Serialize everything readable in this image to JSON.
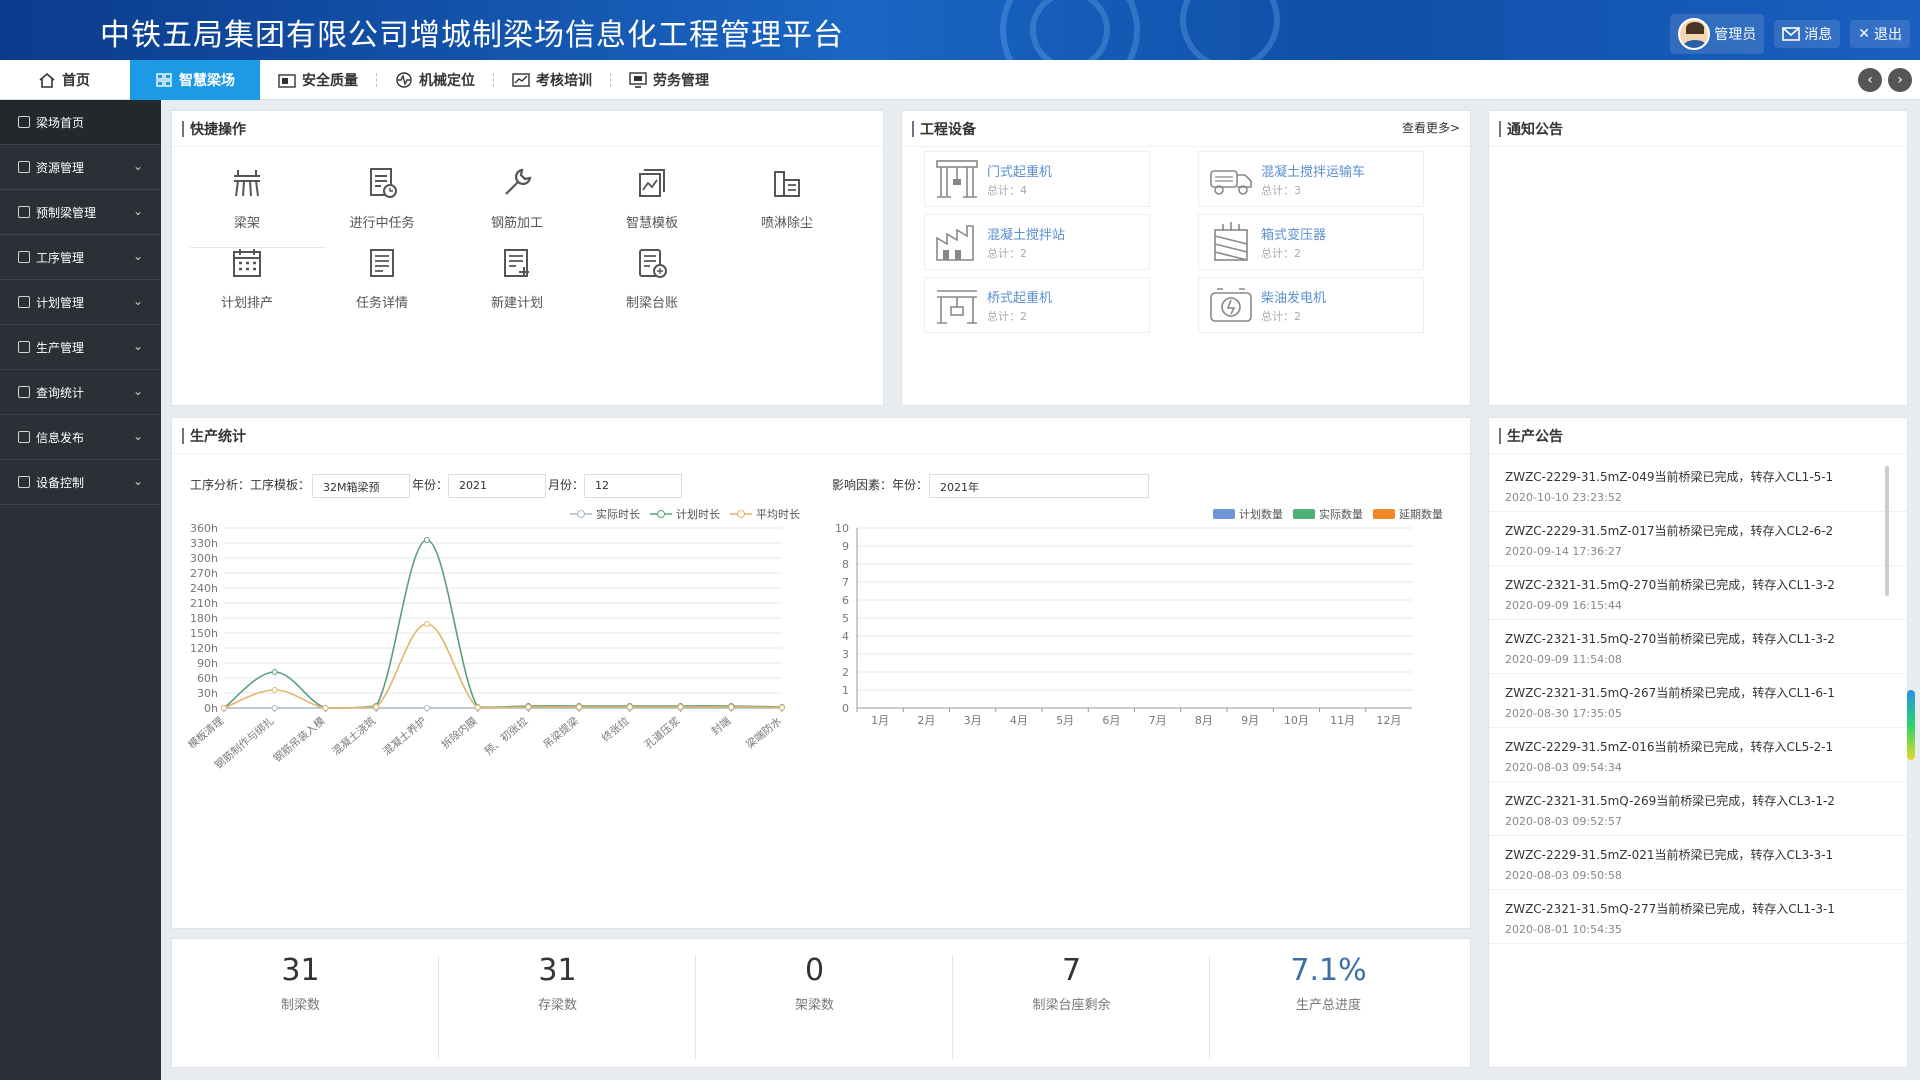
{
  "header": {
    "title": "中铁五局集团有限公司增城制梁场信息化工程管理平台",
    "user_label": "管理员",
    "message_label": "消息",
    "logout_label": "退出"
  },
  "nav": {
    "items": [
      {
        "label": "首页",
        "icon": "home-icon"
      },
      {
        "label": "智慧梁场",
        "icon": "grid-icon",
        "active": true
      },
      {
        "label": "安全质量",
        "icon": "camera-icon"
      },
      {
        "label": "机械定位",
        "icon": "pulse-icon"
      },
      {
        "label": "考核培训",
        "icon": "chart-icon"
      },
      {
        "label": "劳务管理",
        "icon": "monitor-icon"
      }
    ]
  },
  "sidebar": {
    "items": [
      {
        "label": "梁场首页",
        "icon": "home-icon"
      },
      {
        "label": "资源管理",
        "icon": "box-icon"
      },
      {
        "label": "预制梁管理",
        "icon": "beam-icon"
      },
      {
        "label": "工序管理",
        "icon": "layers-icon"
      },
      {
        "label": "计划管理",
        "icon": "doc-icon"
      },
      {
        "label": "生产管理",
        "icon": "factory-icon"
      },
      {
        "label": "查询统计",
        "icon": "scale-icon"
      },
      {
        "label": "信息发布",
        "icon": "file-icon"
      },
      {
        "label": "设备控制",
        "icon": "list-icon"
      }
    ]
  },
  "quick_ops": {
    "title": "快捷操作",
    "items": [
      {
        "label": "梁架",
        "icon": "bridge-icon"
      },
      {
        "label": "进行中任务",
        "icon": "task-icon"
      },
      {
        "label": "钢筋加工",
        "icon": "wrench-icon"
      },
      {
        "label": "智慧模板",
        "icon": "template-icon"
      },
      {
        "label": "喷淋除尘",
        "icon": "spray-icon"
      },
      {
        "label": "计划排产",
        "icon": "calendar-icon"
      },
      {
        "label": "任务详情",
        "icon": "detail-icon"
      },
      {
        "label": "新建计划",
        "icon": "new-plan-icon"
      },
      {
        "label": "制梁台账",
        "icon": "ledger-icon"
      }
    ]
  },
  "equipment": {
    "title": "工程设备",
    "more": "查看更多>",
    "items": [
      {
        "name": "门式起重机",
        "count": "总计：4",
        "icon": "gantry-crane-icon"
      },
      {
        "name": "混凝土搅拌运输车",
        "count": "总计：3",
        "icon": "mixer-truck-icon"
      },
      {
        "name": "混凝土搅拌站",
        "count": "总计：2",
        "icon": "mixing-plant-icon"
      },
      {
        "name": "箱式变压器",
        "count": "总计：2",
        "icon": "transformer-icon"
      },
      {
        "name": "桥式起重机",
        "count": "总计：2",
        "icon": "bridge-crane-icon"
      },
      {
        "name": "柴油发电机",
        "count": "总计：2",
        "icon": "generator-icon"
      }
    ]
  },
  "notice": {
    "title": "通知公告"
  },
  "production": {
    "title": "生产统计",
    "left_form": {
      "label1": "工序分析：工序模板：",
      "template": "32M箱梁预",
      "label2": "年份：",
      "year": "2021",
      "label3": "月份：",
      "month": "12"
    },
    "right_form": {
      "label1": "影响因素：年份：",
      "year": "2021年"
    }
  },
  "chart_data": [
    {
      "type": "line",
      "categories": [
        "模板清理",
        "钢筋制作与绑扎",
        "钢筋吊装入模",
        "混凝土浇筑",
        "混凝土养护",
        "拆除内膜",
        "预、初张拉",
        "吊梁提梁",
        "终张拉",
        "孔道压浆",
        "封端",
        "梁端防水"
      ],
      "series": [
        {
          "name": "实际时长",
          "color": "#a9b7c6",
          "values": [
            0,
            0,
            0,
            0,
            0,
            0,
            0,
            0,
            0,
            0,
            0,
            0
          ]
        },
        {
          "name": "计划时长",
          "color": "#5b9f7a",
          "values": [
            0,
            72,
            0,
            4,
            336,
            2,
            4,
            4,
            4,
            4,
            4,
            2
          ]
        },
        {
          "name": "平均时长",
          "color": "#e6b36b",
          "values": [
            0,
            36,
            0,
            2,
            168,
            1,
            2,
            2,
            2,
            2,
            2,
            1
          ]
        }
      ],
      "yticks": [
        "0h",
        "30h",
        "60h",
        "90h",
        "120h",
        "150h",
        "180h",
        "210h",
        "240h",
        "270h",
        "300h",
        "330h",
        "360h"
      ],
      "ylim": [
        0,
        360
      ]
    },
    {
      "type": "bar",
      "categories": [
        "1月",
        "2月",
        "3月",
        "4月",
        "5月",
        "6月",
        "7月",
        "8月",
        "9月",
        "10月",
        "11月",
        "12月"
      ],
      "series": [
        {
          "name": "计划数量",
          "color": "#6f97d6",
          "values": [
            0,
            0,
            0,
            0,
            0,
            0,
            0,
            0,
            0,
            0,
            0,
            0
          ]
        },
        {
          "name": "实际数量",
          "color": "#4fb07a",
          "values": [
            0,
            0,
            0,
            0,
            0,
            0,
            0,
            0,
            0,
            0,
            0,
            0
          ]
        },
        {
          "name": "延期数量",
          "color": "#f0892a",
          "values": [
            0,
            0,
            0,
            0,
            0,
            0,
            0,
            0,
            0,
            0,
            0,
            0
          ]
        }
      ],
      "yticks": [
        "0",
        "1",
        "2",
        "3",
        "4",
        "5",
        "6",
        "7",
        "8",
        "9",
        "10"
      ],
      "ylim": [
        0,
        10
      ]
    }
  ],
  "stats": [
    {
      "value": "31",
      "label": "制梁数"
    },
    {
      "value": "31",
      "label": "存梁数"
    },
    {
      "value": "0",
      "label": "架梁数"
    },
    {
      "value": "7",
      "label": "制梁台座剩余"
    },
    {
      "value": "7.1%",
      "label": "生产总进度",
      "accent": "#3c6ea8"
    }
  ],
  "announcements": {
    "title": "生产公告",
    "items": [
      {
        "text": "ZWZC-2229-31.5mZ-049当前桥梁已完成，转存入CL1-5-1",
        "date": "2020-10-10 23:23:52"
      },
      {
        "text": "ZWZC-2229-31.5mZ-017当前桥梁已完成，转存入CL2-6-2",
        "date": "2020-09-14 17:36:27"
      },
      {
        "text": "ZWZC-2321-31.5mQ-270当前桥梁已完成，转存入CL1-3-2",
        "date": "2020-09-09 16:15:44"
      },
      {
        "text": "ZWZC-2321-31.5mQ-270当前桥梁已完成，转存入CL1-3-2",
        "date": "2020-09-09 11:54:08"
      },
      {
        "text": "ZWZC-2321-31.5mQ-267当前桥梁已完成，转存入CL1-6-1",
        "date": "2020-08-30 17:35:05"
      },
      {
        "text": "ZWZC-2229-31.5mZ-016当前桥梁已完成，转存入CL5-2-1",
        "date": "2020-08-03 09:54:34"
      },
      {
        "text": "ZWZC-2321-31.5mQ-269当前桥梁已完成，转存入CL3-1-2",
        "date": "2020-08-03 09:52:57"
      },
      {
        "text": "ZWZC-2229-31.5mZ-021当前桥梁已完成，转存入CL3-3-1",
        "date": "2020-08-03 09:50:58"
      },
      {
        "text": "ZWZC-2321-31.5mQ-277当前桥梁已完成，转存入CL1-3-1",
        "date": "2020-08-01 10:54:35"
      }
    ]
  }
}
